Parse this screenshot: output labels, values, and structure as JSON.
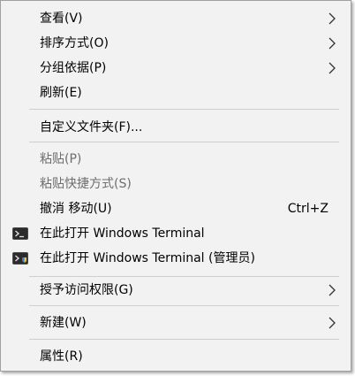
{
  "menu": {
    "items": [
      {
        "label": "查看(V)"
      },
      {
        "label": "排序方式(O)"
      },
      {
        "label": "分组依据(P)"
      },
      {
        "label": "刷新(E)"
      },
      {
        "label": "自定义文件夹(F)..."
      },
      {
        "label": "粘贴(P)"
      },
      {
        "label": "粘贴快捷方式(S)"
      },
      {
        "label": "撤消 移动(U)",
        "shortcut": "Ctrl+Z"
      },
      {
        "label": "在此打开 Windows Terminal"
      },
      {
        "label": "在此打开 Windows Terminal (管理员)"
      },
      {
        "label": "授予访问权限(G)"
      },
      {
        "label": "新建(W)"
      },
      {
        "label": "属性(R)"
      }
    ]
  },
  "icons": {
    "submenu_arrow": "chevron-right-icon",
    "terminal": "windows-terminal-icon",
    "terminal_admin": "windows-terminal-admin-icon"
  },
  "colors": {
    "menu_background": "#f2f2f2",
    "border": "#a0a0a0",
    "disabled_text": "#6d6d6d",
    "separator": "#cfcfcf"
  }
}
